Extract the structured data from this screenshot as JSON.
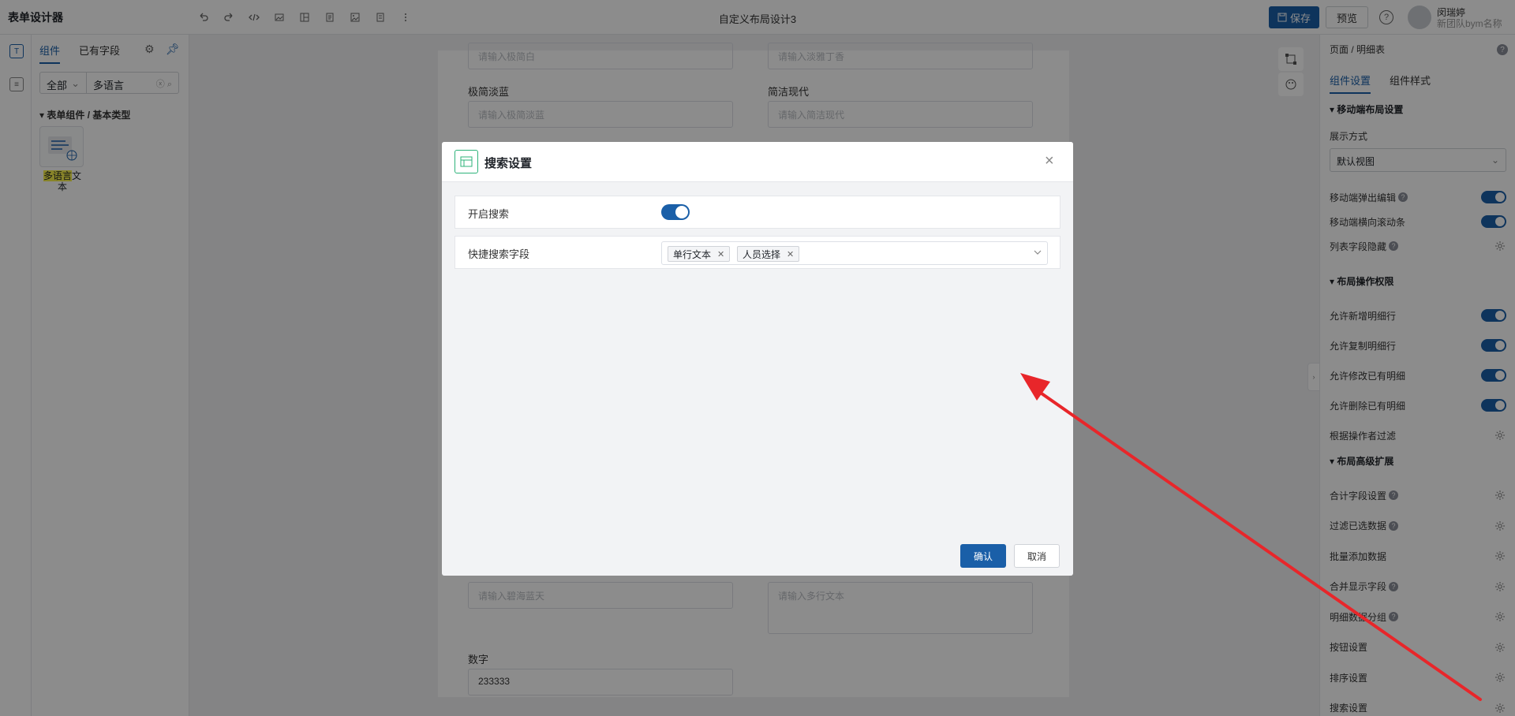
{
  "app": {
    "title": "表单设计器",
    "doc_title": "自定义布局设计3",
    "save_label": "保存",
    "preview_label": "预览",
    "help_label": "?",
    "user_name": "闵瑞婷",
    "user_team": "新团队bym名称"
  },
  "rail": {
    "item1": "T",
    "item2": "≡"
  },
  "left_panel": {
    "tabs": [
      "组件",
      "已有字段"
    ],
    "filter_value": "全部",
    "search_value": "多语言",
    "group_label": "表单组件 / 基本类型",
    "component": {
      "label_highlight": "多语言",
      "label_rest_1": "文",
      "label_rest_2": "本"
    }
  },
  "canvas": {
    "top_placeholder_left": "请输入极简白",
    "top_placeholder_right": "请输入淡雅丁香",
    "field1_label": "极简淡蓝",
    "field1_placeholder": "请输入极简淡蓝",
    "field2_label": "简洁现代",
    "field2_placeholder": "请输入简洁现代",
    "field3_placeholder": "请输入碧海蓝天",
    "field4_placeholder": "请输入多行文本",
    "field5_label": "数字",
    "field5_value": "233333"
  },
  "right_panel": {
    "breadcrumb": "页面 / 明细表",
    "tabs": [
      "组件设置",
      "组件样式"
    ],
    "section1": "移动端布局设置",
    "display_label": "展示方式",
    "display_value": "默认视图",
    "rows1": [
      {
        "label": "移动端弹出编辑",
        "help": true,
        "control": "toggle"
      },
      {
        "label": "移动端横向滚动条",
        "help": false,
        "control": "toggle"
      },
      {
        "label": "列表字段隐藏",
        "help": true,
        "control": "gear"
      }
    ],
    "section2": "布局操作权限",
    "rows2": [
      {
        "label": "允许新增明细行",
        "help": false,
        "control": "toggle"
      },
      {
        "label": "允许复制明细行",
        "help": false,
        "control": "toggle"
      },
      {
        "label": "允许修改已有明细",
        "help": false,
        "control": "toggle"
      },
      {
        "label": "允许删除已有明细",
        "help": false,
        "control": "toggle"
      },
      {
        "label": "根据操作者过滤",
        "help": false,
        "control": "gear"
      }
    ],
    "section3": "布局高级扩展",
    "rows3": [
      {
        "label": "合计字段设置",
        "help": true,
        "control": "gear"
      },
      {
        "label": "过滤已选数据",
        "help": true,
        "control": "gear"
      },
      {
        "label": "批量添加数据",
        "help": false,
        "control": "gear"
      },
      {
        "label": "合并显示字段",
        "help": true,
        "control": "gear"
      },
      {
        "label": "明细数据分组",
        "help": true,
        "control": "gear"
      },
      {
        "label": "按钮设置",
        "help": false,
        "control": "gear"
      },
      {
        "label": "排序设置",
        "help": false,
        "control": "gear"
      },
      {
        "label": "搜索设置",
        "help": false,
        "control": "gear"
      }
    ]
  },
  "modal": {
    "title": "搜索设置",
    "row1_label": "开启搜索",
    "row1_enabled": true,
    "row2_label": "快捷搜索字段",
    "tags": [
      "单行文本",
      "人员选择"
    ],
    "confirm_label": "确认",
    "cancel_label": "取消"
  },
  "colors": {
    "primary": "#1a5fa8",
    "annotation_arrow": "#e8262a",
    "highlight": "#f7f14b"
  }
}
